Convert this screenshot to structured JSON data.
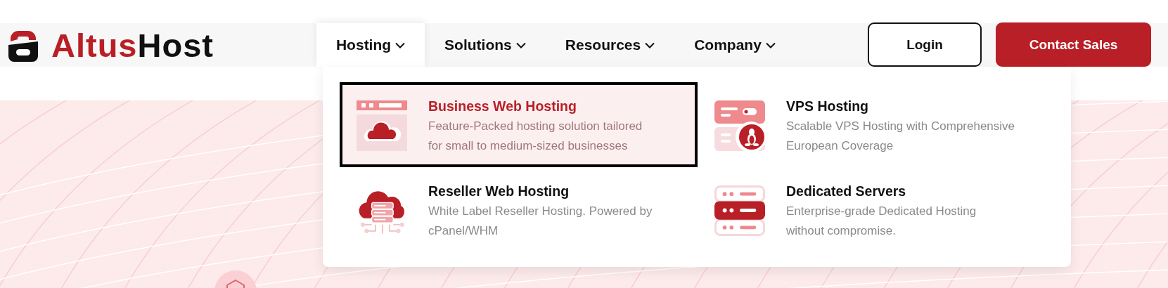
{
  "logo": {
    "parts": [
      {
        "text": "Altus",
        "color": "#b91f26"
      },
      {
        "text": "Host",
        "color": "#111111"
      }
    ]
  },
  "nav": [
    {
      "label": "Hosting",
      "selected": true
    },
    {
      "label": "Solutions",
      "selected": false
    },
    {
      "label": "Resources",
      "selected": false
    },
    {
      "label": "Company",
      "selected": false
    }
  ],
  "buttons": [
    {
      "label": "Login",
      "kind": "outline"
    },
    {
      "label": "Contact Sales",
      "kind": "primary"
    }
  ],
  "menu": {
    "items": [
      {
        "kind": "web",
        "title": "Business Web Hosting",
        "description": "Feature-Packed hosting solution tailored for small to medium-sized businesses",
        "selected": true
      },
      {
        "kind": "vps",
        "title": "VPS Hosting",
        "description": "Scalable VPS Hosting with Comprehensive European Coverage",
        "selected": false
      },
      {
        "kind": "reseller",
        "title": "Reseller Web Hosting",
        "description": "White Label Reseller Hosting. Powered by cPanel/WHM",
        "selected": false
      },
      {
        "kind": "dedicated",
        "title": "Dedicated Servers",
        "description": "Enterprise-grade Dedicated Hosting without compromise.",
        "selected": false
      }
    ]
  }
}
